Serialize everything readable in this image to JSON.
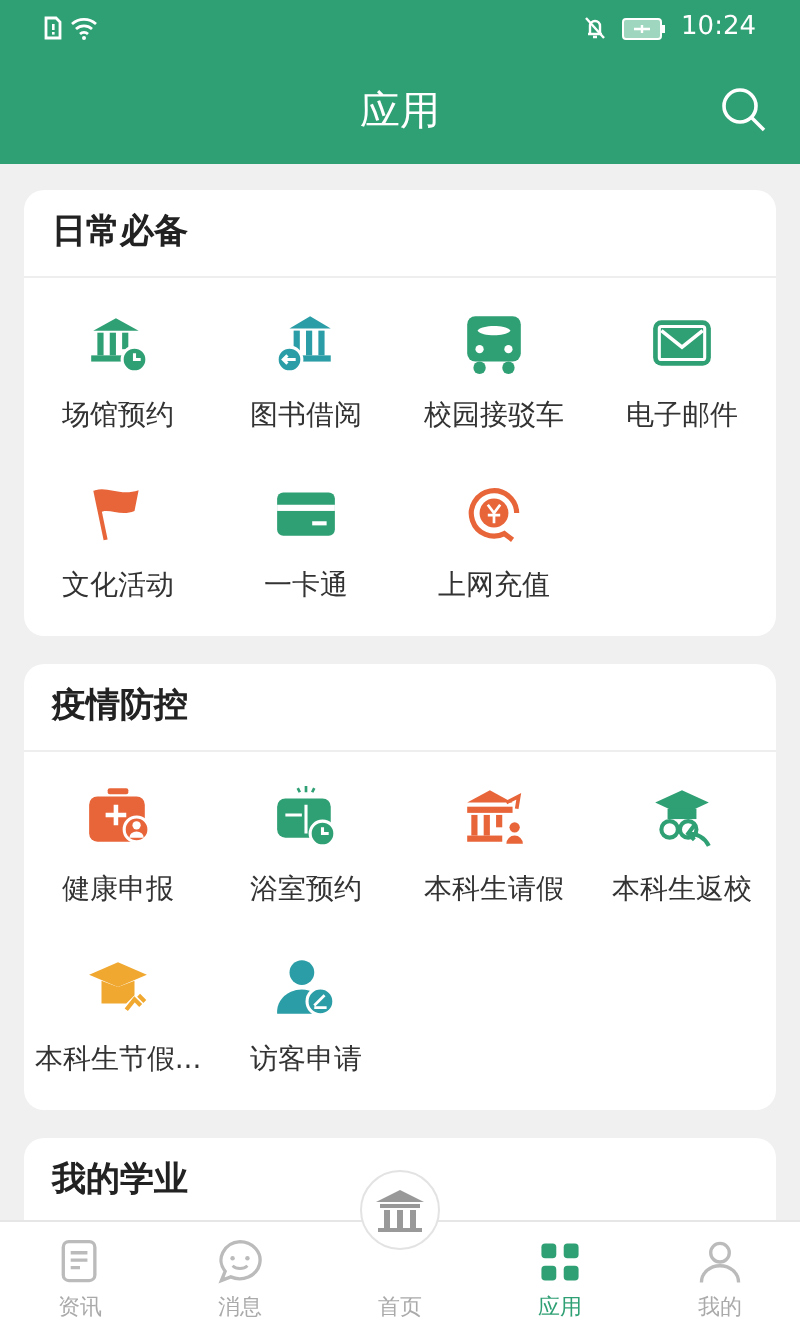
{
  "status_bar": {
    "time": "10:24"
  },
  "header": {
    "title": "应用"
  },
  "sections": [
    {
      "title": "日常必备",
      "apps": [
        {
          "label": "场馆预约"
        },
        {
          "label": "图书借阅"
        },
        {
          "label": "校园接驳车"
        },
        {
          "label": "电子邮件"
        },
        {
          "label": "文化活动"
        },
        {
          "label": "一卡通"
        },
        {
          "label": "上网充值"
        }
      ]
    },
    {
      "title": "疫情防控",
      "apps": [
        {
          "label": "健康申报"
        },
        {
          "label": "浴室预约"
        },
        {
          "label": "本科生请假"
        },
        {
          "label": "本科生返校"
        },
        {
          "label": "本科生节假..."
        },
        {
          "label": "访客申请"
        }
      ]
    },
    {
      "title": "我的学业"
    }
  ],
  "tab_bar": [
    {
      "label": "资讯",
      "selected": false
    },
    {
      "label": "消息",
      "selected": false
    },
    {
      "label": "首页",
      "selected": false
    },
    {
      "label": "应用",
      "selected": true
    },
    {
      "label": "我的",
      "selected": false
    }
  ]
}
